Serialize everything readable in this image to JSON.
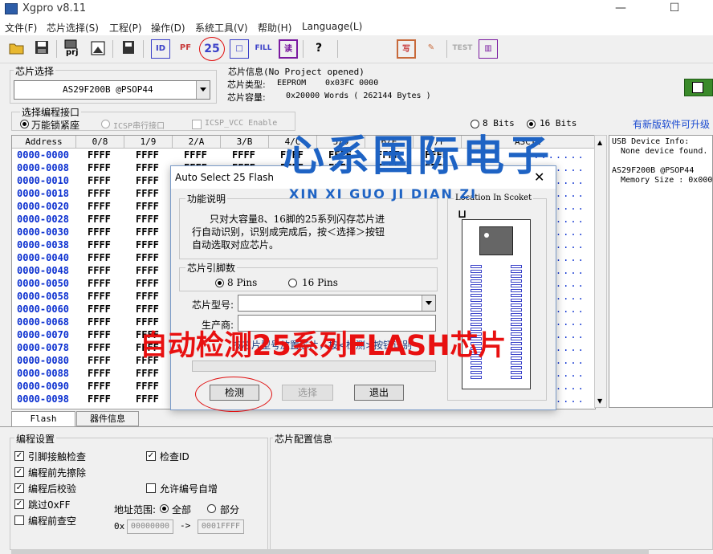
{
  "window": {
    "title": "Xgpro v8.11"
  },
  "menu": [
    "文件(F)",
    "芯片选择(S)",
    "工程(P)",
    "操作(D)",
    "系统工具(V)",
    "帮助(H)",
    "Language(L)"
  ],
  "toolbar": {
    "prj_label": "prj",
    "verify_label": "读",
    "test_label": "TEST",
    "write_label": "写",
    "help_label": "?",
    "fill_label": "FILL",
    "id_label": "ID",
    "read_label": "读"
  },
  "chip_select": {
    "label": "芯片选择",
    "value": "AS29F200B @PSOP44"
  },
  "chip_info": {
    "label": "芯片信息(No Project opened)",
    "type_label": "芯片类型:",
    "type_value": "EEPROM",
    "id_value": "0x03FC 0000",
    "size_label": "芯片容量:",
    "size_value": "0x20000 Words ( 262144 Bytes )"
  },
  "interface": {
    "label": "选择编程接口",
    "opt1": "万能锁紧座",
    "opt2": "ICSP串行接口",
    "opt3": "ICSP_VCC Enable"
  },
  "bits": {
    "opt8": "8 Bits",
    "opt16": "16 Bits"
  },
  "update_link": "有新版软件可升级",
  "grid": {
    "headers": [
      "Address",
      "0/8",
      "1/9",
      "2/A",
      "3/B",
      "4/C",
      "5/D",
      "6/E",
      "7/F",
      "ASCII"
    ],
    "addresses": [
      "0000-0000",
      "0000-0008",
      "0000-0010",
      "0000-0018",
      "0000-0020",
      "0000-0028",
      "0000-0030",
      "0000-0038",
      "0000-0040",
      "0000-0048",
      "0000-0050",
      "0000-0058",
      "0000-0060",
      "0000-0068",
      "0000-0070",
      "0000-0078",
      "0000-0080",
      "0000-0088",
      "0000-0090",
      "0000-0098"
    ],
    "value": "FFFF",
    "ascii_dots": "........"
  },
  "usb": {
    "line1": "USB Device Info:",
    "line2": "None device found.",
    "line3": "AS29F200B @PSOP44",
    "line4": "Memory Size : 0x000"
  },
  "tabs": {
    "flash": "Flash",
    "device_info": "器件信息"
  },
  "prog_settings": {
    "label": "编程设置",
    "pin_check": "引脚接触检查",
    "erase_before": "编程前先擦除",
    "verify_after": "编程后校验",
    "skip_ff": "跳过0xFF",
    "blank_check": "编程前查空",
    "check_id": "检查ID",
    "auto_serial": "允许编号自增",
    "addr_range": "地址范围:",
    "all": "全部",
    "part": "部分",
    "prefix": "0x",
    "start": "00000000",
    "arrow": "->",
    "end": "0001FFFF"
  },
  "chip_config": {
    "label": "芯片配置信息"
  },
  "dialog": {
    "title": "Auto Select 25 Flash",
    "func_label": "功能说明",
    "desc1": "只对大容量8、16脚的25系列闪存芯片进",
    "desc2": "行自动识别，识别成完成后，按＜选择＞按钮",
    "desc3": "自动选取对应芯片。",
    "pins_label": "芯片引脚数",
    "pins8": "8 Pins",
    "pins16": "16 Pins",
    "type_label": "芯片型号:",
    "vendor_label": "生产商:",
    "hint": "按芯片型号放置芯片，按<检测>按钮识别",
    "detect": "检测",
    "select": "选择",
    "exit": "退出",
    "socket_label": "Location In Scoket"
  },
  "overlay": {
    "watermark_cn": "心系国际电子",
    "watermark_py": "XIN XI GUO JI DIAN ZI",
    "caption": "自动检测25系列FLASH芯片"
  },
  "colors": {
    "address": "#0a2fd0",
    "caption": "#e81010",
    "watermark": "#1e63c4",
    "highlight_circle": "#e01010"
  }
}
